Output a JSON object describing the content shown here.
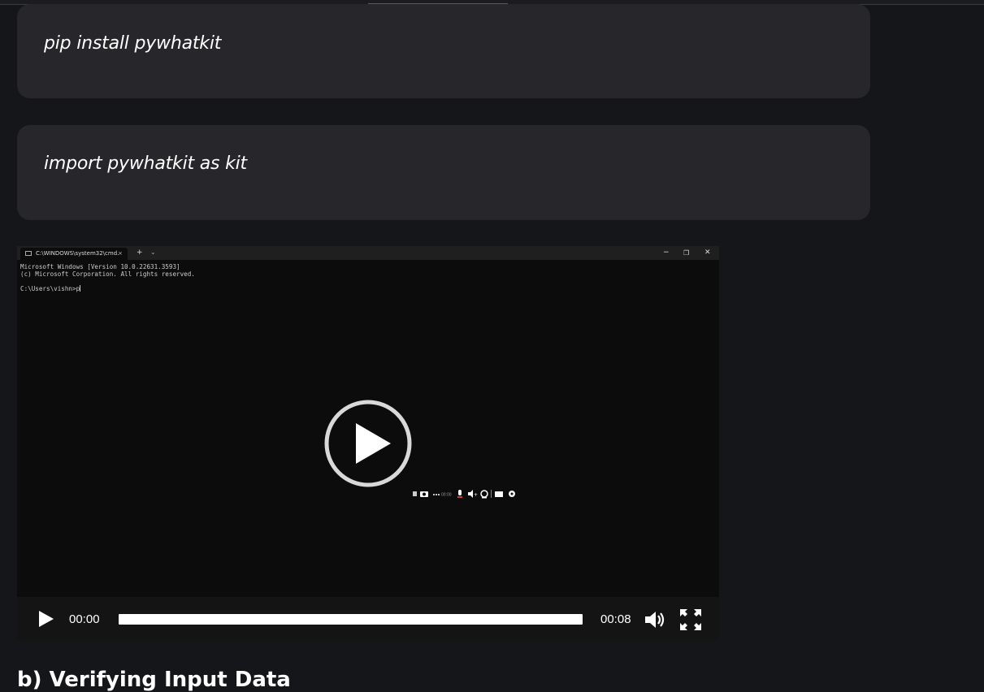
{
  "code_blocks": [
    {
      "text": "pip install pywhatkit"
    },
    {
      "text": "import pywhatkit as kit"
    }
  ],
  "video": {
    "terminal": {
      "tab_title": "C:\\WINDOWS\\system32\\cmd.",
      "tab_close": "×",
      "new_tab": "+",
      "dropdown": "⌄",
      "minimize": "−",
      "maximize": "❐",
      "close": "✕",
      "lines": [
        "Microsoft Windows [Version 10.0.22631.3593]",
        "(c) Microsoft Corporation. All rights reserved.",
        "",
        "C:\\Users\\vishn>p"
      ]
    },
    "recorder_time": "00:00",
    "controls": {
      "current_time": "00:00",
      "duration": "00:08",
      "progress": 0
    }
  },
  "section_heading": "b) Verifying Input Data"
}
